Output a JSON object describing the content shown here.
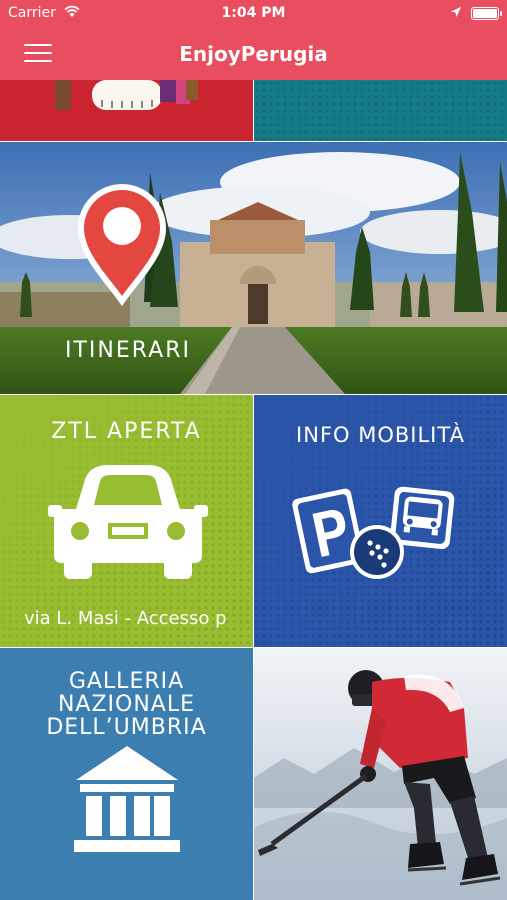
{
  "status_bar": {
    "carrier": "Carrier",
    "time": "1:04 PM"
  },
  "nav_bar": {
    "title": "EnjoyPerugia",
    "menu_icon": "hamburger-menu-icon"
  },
  "tiles": {
    "itinerari": {
      "label": "ITINERARI",
      "icon": "map-pin-icon"
    },
    "ztl": {
      "label": "ZTL APERTA",
      "ticker": "via L. Masi - Accesso p",
      "icon": "car-icon"
    },
    "info": {
      "label": "INFO MOBILITÀ",
      "icons": [
        "parking-icon",
        "bus-icon",
        "minimetro-icon"
      ]
    },
    "galleria": {
      "label_lines": [
        "GALLERIA",
        "NAZIONALE",
        "DELL’UMBRIA"
      ],
      "icon": "museum-icon"
    },
    "hockey": {
      "icon": "hockey-player-image"
    }
  },
  "colors": {
    "accent": "#e84e5f",
    "ztl": "#98bd31",
    "info": "#2a55a8",
    "galleria": "#3d7eb0",
    "teal": "#147a86",
    "red": "#c9242f"
  }
}
